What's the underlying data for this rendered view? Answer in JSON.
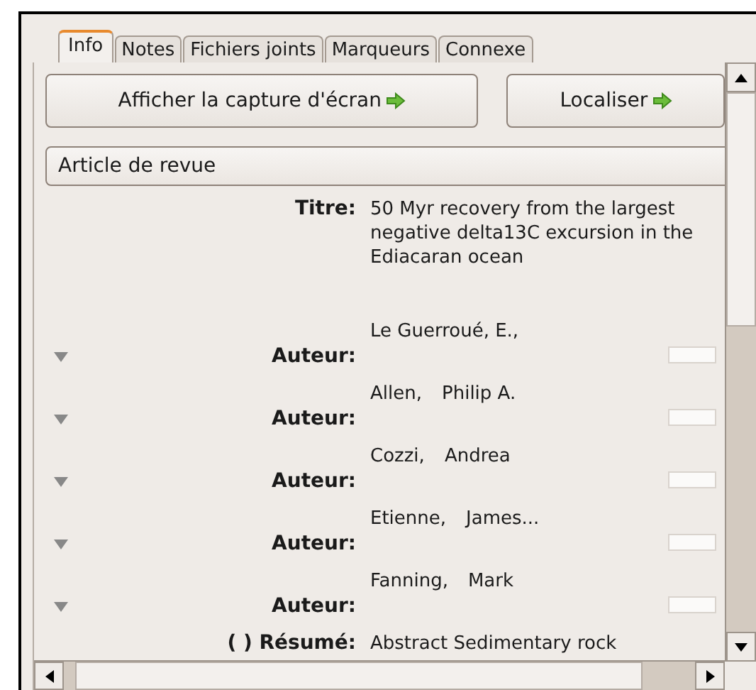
{
  "tabs": [
    {
      "label": "Info",
      "selected": true
    },
    {
      "label": "Notes",
      "selected": false
    },
    {
      "label": "Fichiers joints",
      "selected": false
    },
    {
      "label": "Marqueurs",
      "selected": false
    },
    {
      "label": "Connexe",
      "selected": false
    }
  ],
  "buttons": [
    {
      "label": "Afficher la capture d'écran"
    },
    {
      "label": "Localiser"
    }
  ],
  "item_type": {
    "value": "Article de revue"
  },
  "fields": [
    {
      "kind": "title",
      "label": "Titre:",
      "value": "50 Myr recovery from the largest negative delta13C excursion in the Ediacaran ocean"
    },
    {
      "kind": "creator",
      "label": "Auteur:",
      "names": [
        "Le Guerroué, E.,"
      ]
    },
    {
      "kind": "creator",
      "label": "Auteur:",
      "names": [
        "Allen,",
        "Philip A."
      ]
    },
    {
      "kind": "creator",
      "label": "Auteur:",
      "names": [
        "Cozzi,",
        "Andrea"
      ]
    },
    {
      "kind": "creator",
      "label": "Auteur:",
      "names": [
        "Etienne,",
        "James..."
      ]
    },
    {
      "kind": "creator",
      "label": "Auteur:",
      "names": [
        "Fanning,",
        "Mark"
      ]
    },
    {
      "kind": "abstract",
      "toggle": "(   )",
      "label": "Résumé:",
      "value": "Abstract Sedimentary rock"
    }
  ]
}
